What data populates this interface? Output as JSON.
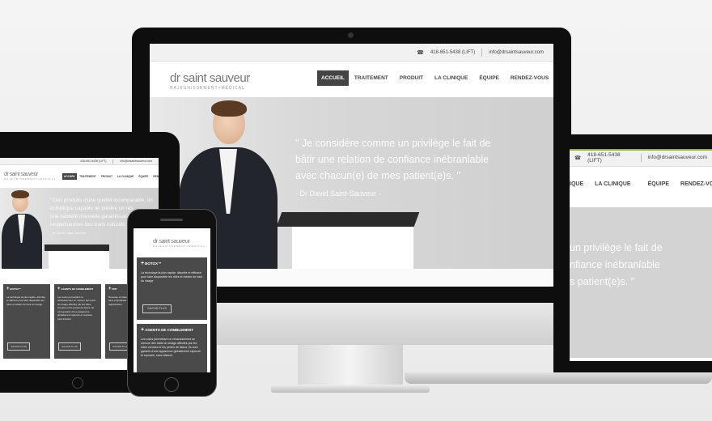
{
  "site": {
    "logo_main": "dr saint sauveur",
    "logo_sub_a": "RAJEUNISSEMENT",
    "logo_sub_plus": "+",
    "logo_sub_b": "MÉDICAL",
    "phone": "418-651-5438 (LIFT)",
    "email": "info@drsaintsauveur.com",
    "nav": [
      "ACCUEIL",
      "TRAITEMENT",
      "PRODUIT",
      "LA CLINIQUE",
      "ÉQUIPE",
      "RENDEZ-VOUS"
    ],
    "accent_color": "#8ab33b"
  },
  "desktop": {
    "quote_lines": [
      "\" Je considère comme un privilège le fait de",
      "bâtir une relation de confiance inébranlable",
      "avec chacun(e) de mes patient(e)s. \""
    ],
    "author": "- Dr David Saint-Sauveur -"
  },
  "laptop": {
    "nav_visible": [
      "IQUE",
      "LA CLINIQUE",
      "ÉQUIPE",
      "RENDEZ-VOUS"
    ],
    "quote_lines": [
      "un privilège le fait de",
      "nfiance inébranlable",
      "s patient(e)s. \""
    ]
  },
  "tablet": {
    "quote_lines": [
      "\" Des produits d'une qualité incomparable, un",
      "esthétique capable de prédire un rés",
      "une habileté manuelle garantissant",
      "respectueuses des traits naturels"
    ],
    "author": "- Dr David Saint-Sauveur -",
    "cards": [
      {
        "title": "BOTOX™",
        "body": "La technique la plus rapide, discrète et efficace pour faire disparaître les rides et ridules du haut du visage.",
        "button": "SAVOIR PLUS"
      },
      {
        "title": "AGENTS DE COMBLEMENT",
        "body": "Les soins permettant un rehaussement un mesure des traits du visage affectés par les rides creuses et les pertes de tissus. Ils sont garants d'une apparence globalement rajeunie et reposée, sans bistouri.",
        "button": "SAVOIR PLUS"
      },
      {
        "title": "PRP",
        "body": "Nouveau et traitement aux propriétés sans propriétaire le régénératrice de régénération.",
        "button": "SAVOIR PLUS"
      }
    ]
  },
  "phone": {
    "cards": [
      {
        "title": "BOTOX™",
        "body": "La technique la plus rapide, discrète et efficace pour faire disparaître les rides et ridules du haut du visage.",
        "button": "SAVOIR PLUS"
      },
      {
        "title": "AGENTS DE COMBLEMENT",
        "body": "Les soins permettant un rehaussement un mesure des traits du visage affectés par les rides creuses et les pertes de tissus. Ils sont garants d'une apparence globalement rajeunie et reposée, sans bistouri.",
        "button": ""
      }
    ]
  }
}
